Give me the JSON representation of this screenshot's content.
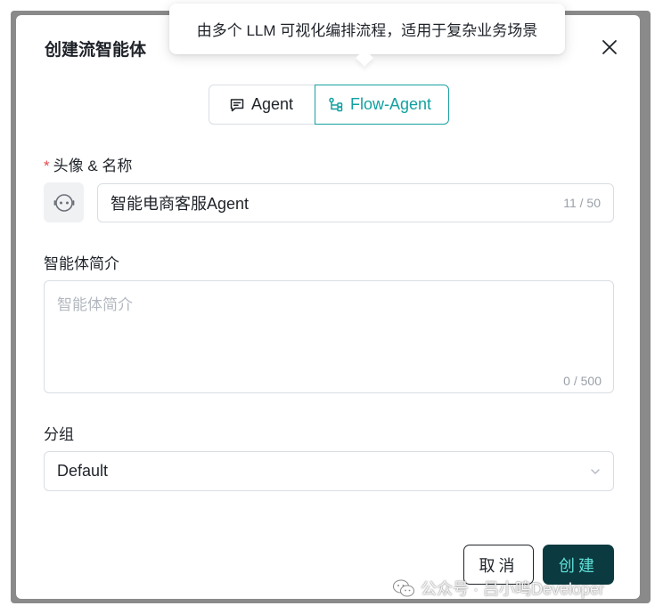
{
  "dialog": {
    "title": "创建流智能体",
    "tooltip": "由多个 LLM 可视化编排流程，适用于复杂业务场景",
    "close_icon": "close-icon"
  },
  "mode_switch": {
    "options": [
      {
        "label": "Agent",
        "icon": "chat-icon",
        "selected": false
      },
      {
        "label": "Flow-Agent",
        "icon": "flow-icon",
        "selected": true
      }
    ],
    "accent_color": "#18a0a0"
  },
  "form": {
    "name_field": {
      "required_mark": "*",
      "label": "头像 & 名称",
      "avatar_icon": "robot-icon",
      "value": "智能电商客服Agent",
      "counter": "11 / 50"
    },
    "description_field": {
      "label": "智能体简介",
      "placeholder": "智能体简介",
      "counter": "0 / 500"
    },
    "group_field": {
      "label": "分组",
      "selected": "Default",
      "chevron_icon": "chevron-down-icon"
    }
  },
  "footer": {
    "cancel_label": "取消",
    "create_label": "创建",
    "create_bg": "#0b3a40",
    "create_text_color": "#5fe0d8"
  },
  "watermark": {
    "text": "公众号 · 吕小鸣Developer",
    "icon": "wechat-icon"
  }
}
